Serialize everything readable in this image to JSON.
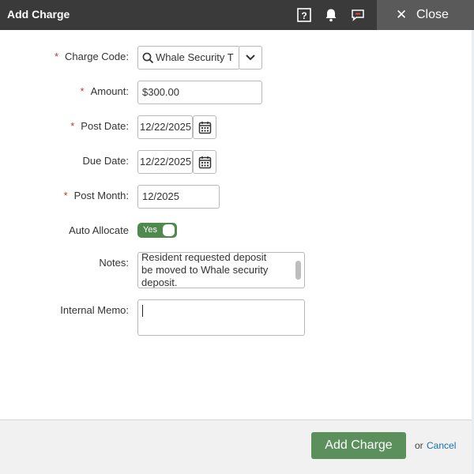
{
  "header": {
    "title": "Add Charge",
    "help_icon": "help-icon",
    "notifications_icon": "bell-icon",
    "chat_icon": "chat-icon",
    "close_label": "Close"
  },
  "form": {
    "charge_code": {
      "label": "Charge Code:",
      "value": "Whale Security T",
      "required": true
    },
    "amount": {
      "label": "Amount:",
      "value": "$300.00",
      "required": true
    },
    "post_date": {
      "label": "Post Date:",
      "value": "12/22/2025",
      "required": true
    },
    "due_date": {
      "label": "Due Date:",
      "value": "12/22/2025",
      "required": false
    },
    "post_month": {
      "label": "Post Month:",
      "value": "12/2025",
      "required": true
    },
    "auto_allocate": {
      "label": "Auto Allocate",
      "toggle_label": "Yes",
      "on": true
    },
    "notes": {
      "label": "Notes:",
      "lines": [
        "Resident requested deposit",
        "be moved to Whale security",
        "deposit."
      ]
    },
    "internal_memo": {
      "label": "Internal Memo:",
      "value": ""
    },
    "required_marker": "*"
  },
  "footer": {
    "submit_label": "Add Charge",
    "or_text": "or",
    "cancel_label": "Cancel"
  },
  "colors": {
    "header_bg": "#3a3a3a",
    "close_bg": "#5a5a5a",
    "primary_green": "#5b8f5b",
    "required_red": "#c0392b",
    "link_blue": "#1a6fb5"
  }
}
